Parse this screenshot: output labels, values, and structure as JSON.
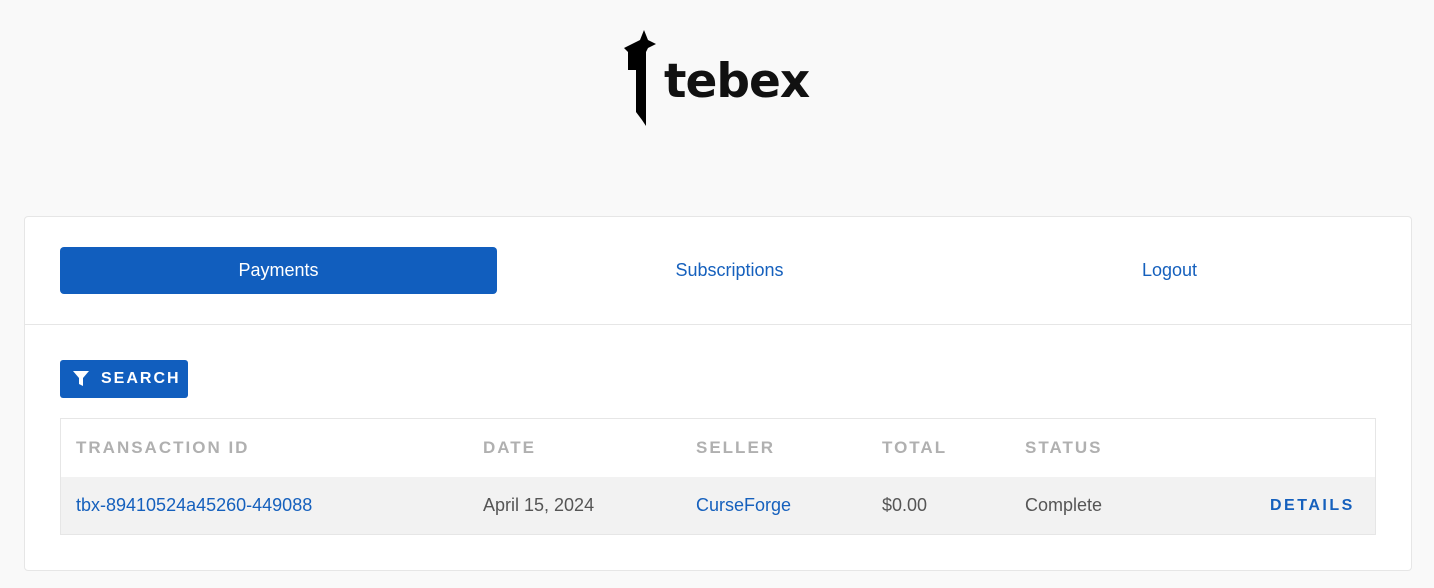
{
  "brand": {
    "name": "tebex",
    "logo_icon": "tebex-logo-icon"
  },
  "nav": {
    "tabs": [
      {
        "label": "Payments",
        "active": true
      },
      {
        "label": "Subscriptions",
        "active": false
      },
      {
        "label": "Logout",
        "active": false
      }
    ]
  },
  "toolbar": {
    "search_label": "SEARCH",
    "search_icon": "filter-icon"
  },
  "table": {
    "columns": [
      "TRANSACTION ID",
      "DATE",
      "SELLER",
      "TOTAL",
      "STATUS"
    ],
    "rows": [
      {
        "transaction_id": "tbx-89410524a45260-449088",
        "date": "April 15, 2024",
        "seller": "CurseForge",
        "total": "$0.00",
        "status": "Complete",
        "action": "DETAILS"
      }
    ]
  },
  "colors": {
    "accent": "#115ebe",
    "link": "#1560bd",
    "background": "#f9f9f9"
  }
}
